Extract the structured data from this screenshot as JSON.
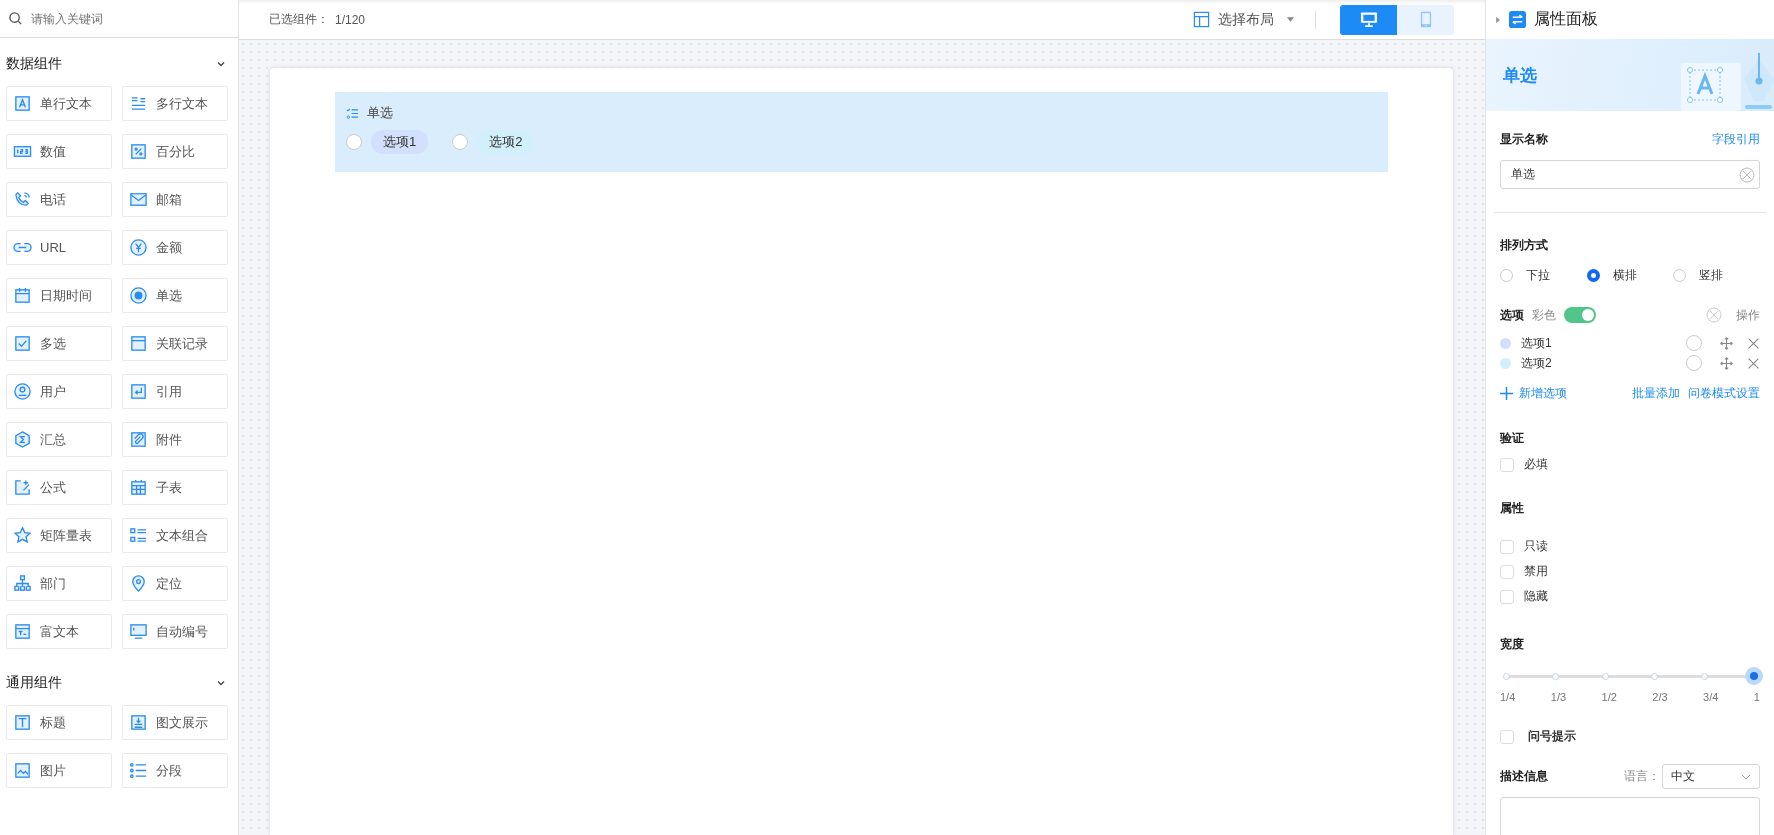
{
  "sidebar": {
    "search": {
      "placeholder": "请输入关键词"
    },
    "sections": [
      {
        "title": "数据组件",
        "expanded": true,
        "items": [
          "单行文本",
          "多行文本",
          "数值",
          "百分比",
          "电话",
          "邮箱",
          "URL",
          "金额",
          "日期时间",
          "单选",
          "多选",
          "关联记录",
          "用户",
          "引用",
          "汇总",
          "附件",
          "公式",
          "子表",
          "矩阵量表",
          "文本组合",
          "部门",
          "定位",
          "富文本",
          "自动编号"
        ]
      },
      {
        "title": "通用组件",
        "expanded": true,
        "items": [
          "标题",
          "图文展示",
          "图片",
          "分段"
        ]
      }
    ]
  },
  "toolbar": {
    "selected_label": "已选组件：",
    "selected_count": "1/120",
    "layout_button": "选择布局",
    "devices": [
      {
        "kind": "desktop",
        "selected": true
      },
      {
        "kind": "mobile",
        "selected": false
      }
    ]
  },
  "canvas": {
    "field": {
      "title": "单选",
      "selected": true,
      "options": [
        {
          "label": "选项1",
          "checked": false,
          "color": "#d3e0fd"
        },
        {
          "label": "选项2",
          "checked": false,
          "color": "#d2effc"
        }
      ]
    }
  },
  "panel": {
    "title": "属性面板",
    "banner_title": "单选",
    "display_name": {
      "label": "显示名称",
      "link": "字段引用",
      "value": "单选"
    },
    "arrangement": {
      "label": "排列方式",
      "options": [
        {
          "label": "下拉",
          "selected": false
        },
        {
          "label": "横排",
          "selected": true
        },
        {
          "label": "竖排",
          "selected": false
        }
      ]
    },
    "options": {
      "label": "选项",
      "color_label": "彩色",
      "color_on": true,
      "action_label": "操作",
      "items": [
        {
          "label": "选项1",
          "color": "#d3e0fd",
          "default": false
        },
        {
          "label": "选项2",
          "color": "#d2effc",
          "default": false
        }
      ],
      "add": "新增选项",
      "bulk": "批量添加",
      "survey": "问卷模式设置"
    },
    "validation": {
      "label": "验证",
      "items": [
        {
          "label": "必填",
          "checked": false
        }
      ]
    },
    "properties": {
      "label": "属性",
      "items": [
        {
          "label": "只读",
          "checked": false
        },
        {
          "label": "禁用",
          "checked": false
        },
        {
          "label": "隐藏",
          "checked": false
        }
      ]
    },
    "width": {
      "label": "宽度",
      "level": 1,
      "ticks": [
        "1/4",
        "1/3",
        "1/2",
        "2/3",
        "3/4",
        "1"
      ]
    },
    "hint": {
      "label": "问号提示",
      "checked": false
    },
    "description": {
      "label": "描述信息",
      "language_label": "语言：",
      "language": "中文"
    }
  }
}
